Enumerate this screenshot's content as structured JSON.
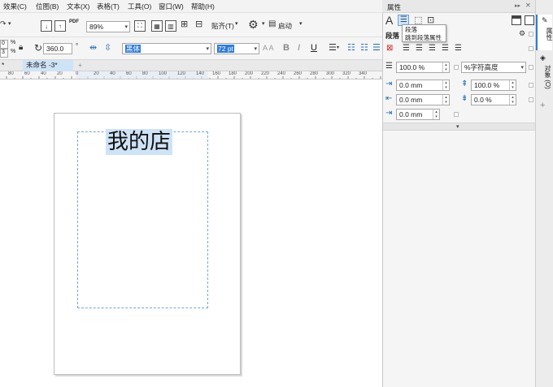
{
  "menu": {
    "items": [
      "效果(C)",
      "位图(B)",
      "文本(X)",
      "表格(T)",
      "工具(O)",
      "窗口(W)",
      "帮助(H)"
    ]
  },
  "toolbar": {
    "zoom": "89%",
    "snap_label": "贴齐(T)",
    "launch_label": "启动",
    "pdf_label": "PDF"
  },
  "property_bar": {
    "pct_a": "0",
    "pct_b": "3",
    "pct_unit": "%",
    "rotation": "360.0",
    "rotation_unit": "°",
    "font_name": "黑体",
    "font_size": "72 pt",
    "bold": "B",
    "italic": "I",
    "underline": "U",
    "aa_label": "A A"
  },
  "doc_tabs": {
    "partial": "*",
    "active": "未命名 -3*",
    "add": "+"
  },
  "ruler": {
    "labels": [
      "80",
      "60",
      "40",
      "20",
      "0",
      "20",
      "40",
      "60",
      "80",
      "100",
      "120",
      "140",
      "160",
      "180",
      "200",
      "220",
      "240",
      "260",
      "280",
      "300",
      "320",
      "340"
    ]
  },
  "canvas": {
    "shop_text": "我的店"
  },
  "panel": {
    "title": "属性",
    "collapse": "▸▸",
    "section_label": "段落",
    "tooltip_title": "段落",
    "tooltip_desc": "跳到段落属性",
    "line_spacing": "100.0 %",
    "line_spacing_unit": "%字符高度",
    "indent_left": "0.0 mm",
    "indent_right": "0.0 mm",
    "first_line": "0.0 mm",
    "para_spacing_before": "100.0 %",
    "para_spacing_after": "0.0 %",
    "expand": "▾",
    "close_x": "✕",
    "add_tab": "+"
  },
  "side_tabs": {
    "properties": "属性",
    "objects": "对象 (O)"
  }
}
